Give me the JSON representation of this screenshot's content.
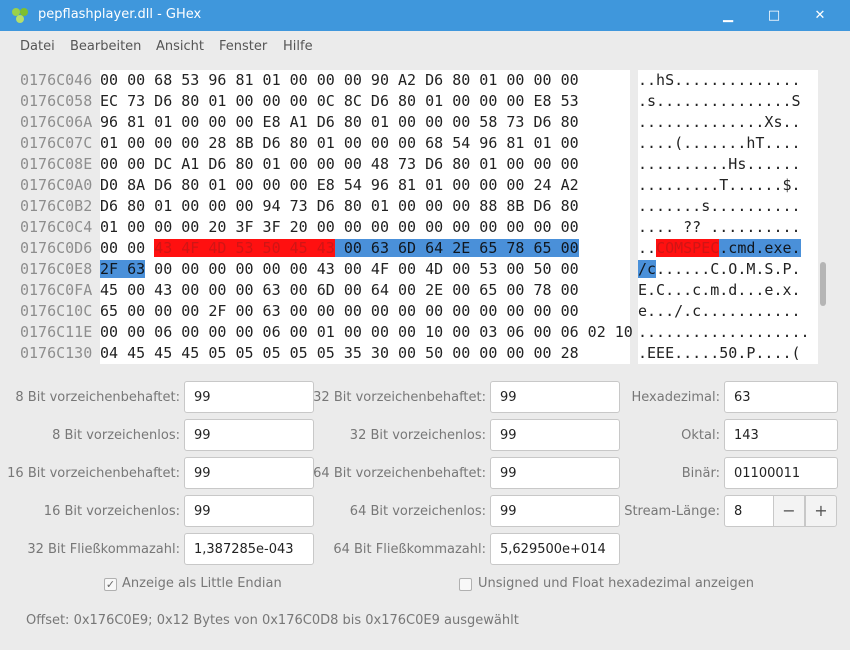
{
  "window": {
    "title": "pepflashplayer.dll - GHex",
    "min_icon": "minimize-icon",
    "max_icon": "maximize-icon",
    "close_icon": "close-icon",
    "min_glyph": "▁",
    "max_glyph": "□",
    "close_glyph": "✕",
    "colors": {
      "titlebar": "#3f97dc",
      "selection_red": "#ff1010",
      "selection_blue": "#4a90d9"
    }
  },
  "menu": [
    "Datei",
    "Bearbeiten",
    "Ansicht",
    "Fenster",
    "Hilfe"
  ],
  "hex_rows": [
    {
      "offset": "0176C046",
      "hex": "00 00 68 53 96 81 01 00 00 00 90 A2 D6 80 01 00 00 00",
      "ascii": "..hS.............."
    },
    {
      "offset": "0176C058",
      "hex": "EC 73 D6 80 01 00 00 00 0C 8C D6 80 01 00 00 00 E8 53",
      "ascii": ".s...............S"
    },
    {
      "offset": "0176C06A",
      "hex": "96 81 01 00 00 00 E8 A1 D6 80 01 00 00 00 58 73 D6 80",
      "ascii": "..............Xs.."
    },
    {
      "offset": "0176C07C",
      "hex": "01 00 00 00 28 8B D6 80 01 00 00 00 68 54 96 81 01 00",
      "ascii": "....(.......hT...."
    },
    {
      "offset": "0176C08E",
      "hex": "00 00 DC A1 D6 80 01 00 00 00 48 73 D6 80 01 00 00 00",
      "ascii": "..........Hs......"
    },
    {
      "offset": "0176C0A0",
      "hex": "D0 8A D6 80 01 00 00 00 E8 54 96 81 01 00 00 00 24 A2",
      "ascii": ".........T......$."
    },
    {
      "offset": "0176C0B2",
      "hex": "D6 80 01 00 00 00 94 73 D6 80 01 00 00 00 88 8B D6 80",
      "ascii": ".......s.........."
    },
    {
      "offset": "0176C0C4",
      "hex": "01 00 00 00 20 3F 3F 20 00 00 00 00 00 00 00 00 00 00",
      "ascii": ".... ?? .........."
    },
    {
      "offset": "0176C0D6",
      "hex": "",
      "ascii": "",
      "sel": true,
      "hex_pre": "00 00 ",
      "hex_red": "43 4F 4D 53 50 45 43",
      "hex_blue": " 00 63 6D 64 2E 65 78 65 00",
      "ascii_pre": "..",
      "ascii_red": "COMSPEC",
      "ascii_blue": ".cmd.exe."
    },
    {
      "offset": "0176C0E8",
      "hex": "",
      "ascii": "",
      "sel2": true,
      "hex_blue": "2F 63",
      "hex_post": " 00 00 00 00 00 00 43 00 4F 00 4D 00 53 00 50 00",
      "ascii_blue": "/c",
      "ascii_post": "......C.O.M.S.P."
    },
    {
      "offset": "0176C0FA",
      "hex": "45 00 43 00 00 00 63 00 6D 00 64 00 2E 00 65 00 78 00",
      "ascii": "E.C...c.m.d...e.x."
    },
    {
      "offset": "0176C10C",
      "hex": "65 00 00 00 2F 00 63 00 00 00 00 00 00 00 00 00 00 00",
      "ascii": "e.../.c..........."
    },
    {
      "offset": "0176C11E",
      "hex": "00 00 06 00 00 00 06 00 01 00 00 00 10 00 03 06 00 06 02 10",
      "ascii": "..................."
    },
    {
      "offset": "0176C130",
      "hex": "04 45 45 45 05 05 05 05 05 35 30 00 50 00 00 00 00 28",
      "ascii": ".EEE.....50.P....("
    }
  ],
  "fields": {
    "s8_label": "8 Bit vorzeichenbehaftet:",
    "s8": "99",
    "u8_label": "8 Bit vorzeichenlos:",
    "u8": "99",
    "s16_label": "16 Bit vorzeichenbehaftet:",
    "s16": "99",
    "u16_label": "16 Bit vorzeichenlos:",
    "u16": "99",
    "f32_label": "32 Bit Fließkommazahl:",
    "f32": "1,387285e-043",
    "s32_label": "32 Bit vorzeichenbehaftet:",
    "s32": "99",
    "u32_label": "32 Bit vorzeichenlos:",
    "u32": "99",
    "s64_label": "64 Bit vorzeichenbehaftet:",
    "s64": "99",
    "u64_label": "64 Bit vorzeichenlos:",
    "u64": "99",
    "f64_label": "64 Bit Fließkommazahl:",
    "f64": "5,629500e+014",
    "hex_label": "Hexadezimal:",
    "hex": "63",
    "oct_label": "Oktal:",
    "oct": "143",
    "bin_label": "Binär:",
    "bin": "01100011",
    "stream_label": "Stream-Länge:",
    "stream": "8",
    "minus": "−",
    "plus": "+"
  },
  "options": {
    "little_endian_label": "Anzeige als Little Endian",
    "little_endian_checked": true,
    "unsigned_hex_label": "Unsigned und Float hexadezimal anzeigen",
    "unsigned_hex_checked": false,
    "check_glyph": "✓"
  },
  "status": "Offset: 0x176C0E9; 0x12 Bytes von 0x176C0D8 bis 0x176C0E9 ausgewählt"
}
